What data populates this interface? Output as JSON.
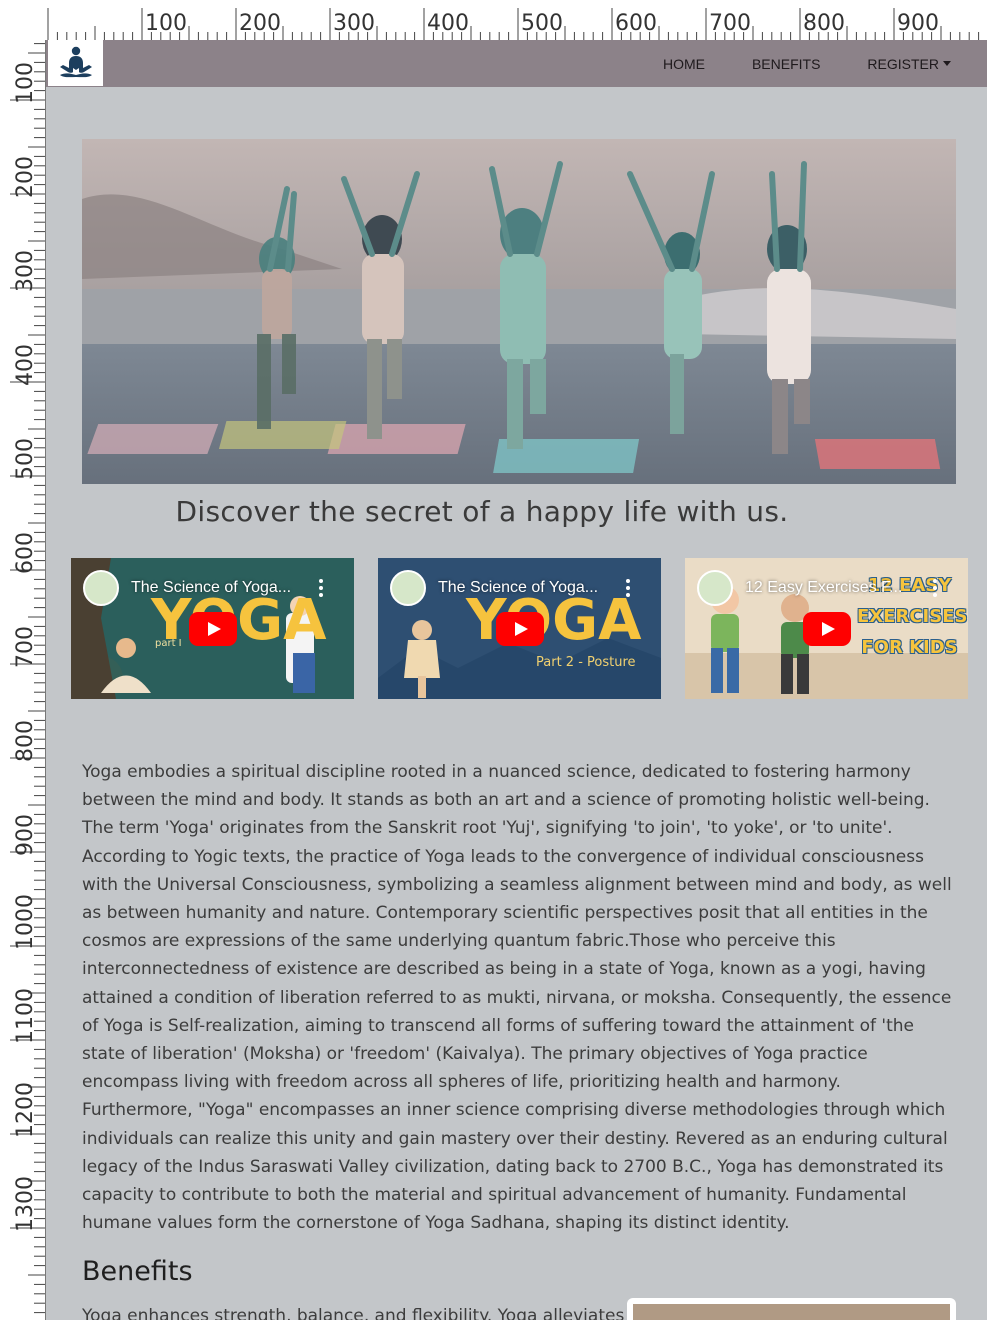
{
  "ruler": {
    "top_labels": [
      "100",
      "200",
      "300",
      "400",
      "500",
      "600",
      "700",
      "800",
      "900"
    ],
    "left_labels": [
      "100",
      "200",
      "300",
      "400",
      "500",
      "600",
      "700",
      "800",
      "900",
      "1000",
      "1100",
      "1200",
      "1300"
    ]
  },
  "navbar": {
    "brand_icon": "yoga-meditation-icon",
    "links": [
      {
        "label": "HOME"
      },
      {
        "label": "BENEFITS"
      },
      {
        "label": "REGISTER"
      }
    ]
  },
  "hero": {
    "tagline": "Discover the secret of a happy life with us."
  },
  "videos": [
    {
      "title": "The Science of Yoga...",
      "thumb_text": "YOGA",
      "thumb_sub": "part I",
      "icon": "play-icon"
    },
    {
      "title": "The Science of Yoga...",
      "thumb_text": "YOGA",
      "thumb_sub": "Part 2 - Posture",
      "icon": "play-icon"
    },
    {
      "title": "12 Easy Exercises F...",
      "thumb_text": "12 EASY EXERCISES FOR KIDS",
      "thumb_sub": "",
      "icon": "play-icon"
    }
  ],
  "about": {
    "text": "Yoga embodies a spiritual discipline rooted in a nuanced science, dedicated to fostering harmony between the mind and body. It stands as both an art and a science of promoting holistic well-being. The term 'Yoga' originates from the Sanskrit root 'Yuj', signifying 'to join', 'to yoke', or 'to unite'. According to Yogic texts, the practice of Yoga leads to the convergence of individual consciousness with the Universal Consciousness, symbolizing a seamless alignment between mind and body, as well as between humanity and nature. Contemporary scientific perspectives posit that all entities in the cosmos are expressions of the same underlying quantum fabric.Those who perceive this interconnectedness of existence are described as being in a state of Yoga, known as a yogi, having attained a condition of liberation referred to as mukti, nirvana, or moksha. Consequently, the essence of Yoga is Self-realization, aiming to transcend all forms of suffering toward the attainment of 'the state of liberation' (Moksha) or 'freedom' (Kaivalya). The primary objectives of Yoga practice encompass living with freedom across all spheres of life, prioritizing health and harmony. Furthermore, \"Yoga\" encompasses an inner science comprising diverse methodologies through which individuals can realize this unity and gain mastery over their destiny. Revered as an enduring cultural legacy of the Indus Saraswati Valley civilization, dating back to 2700 B.C., Yoga has demonstrated its capacity to contribute to both the material and spiritual advancement of humanity. Fundamental humane values form the cornerstone of Yoga Sadhana, shaping its distinct identity."
  },
  "benefits": {
    "heading": "Benefits",
    "text": "Yoga enhances strength, balance, and flexibility. Yoga alleviates"
  },
  "colors": {
    "navbar": "#8c8289",
    "page": "#c3c6c9",
    "youtube_red": "#ff0000"
  }
}
